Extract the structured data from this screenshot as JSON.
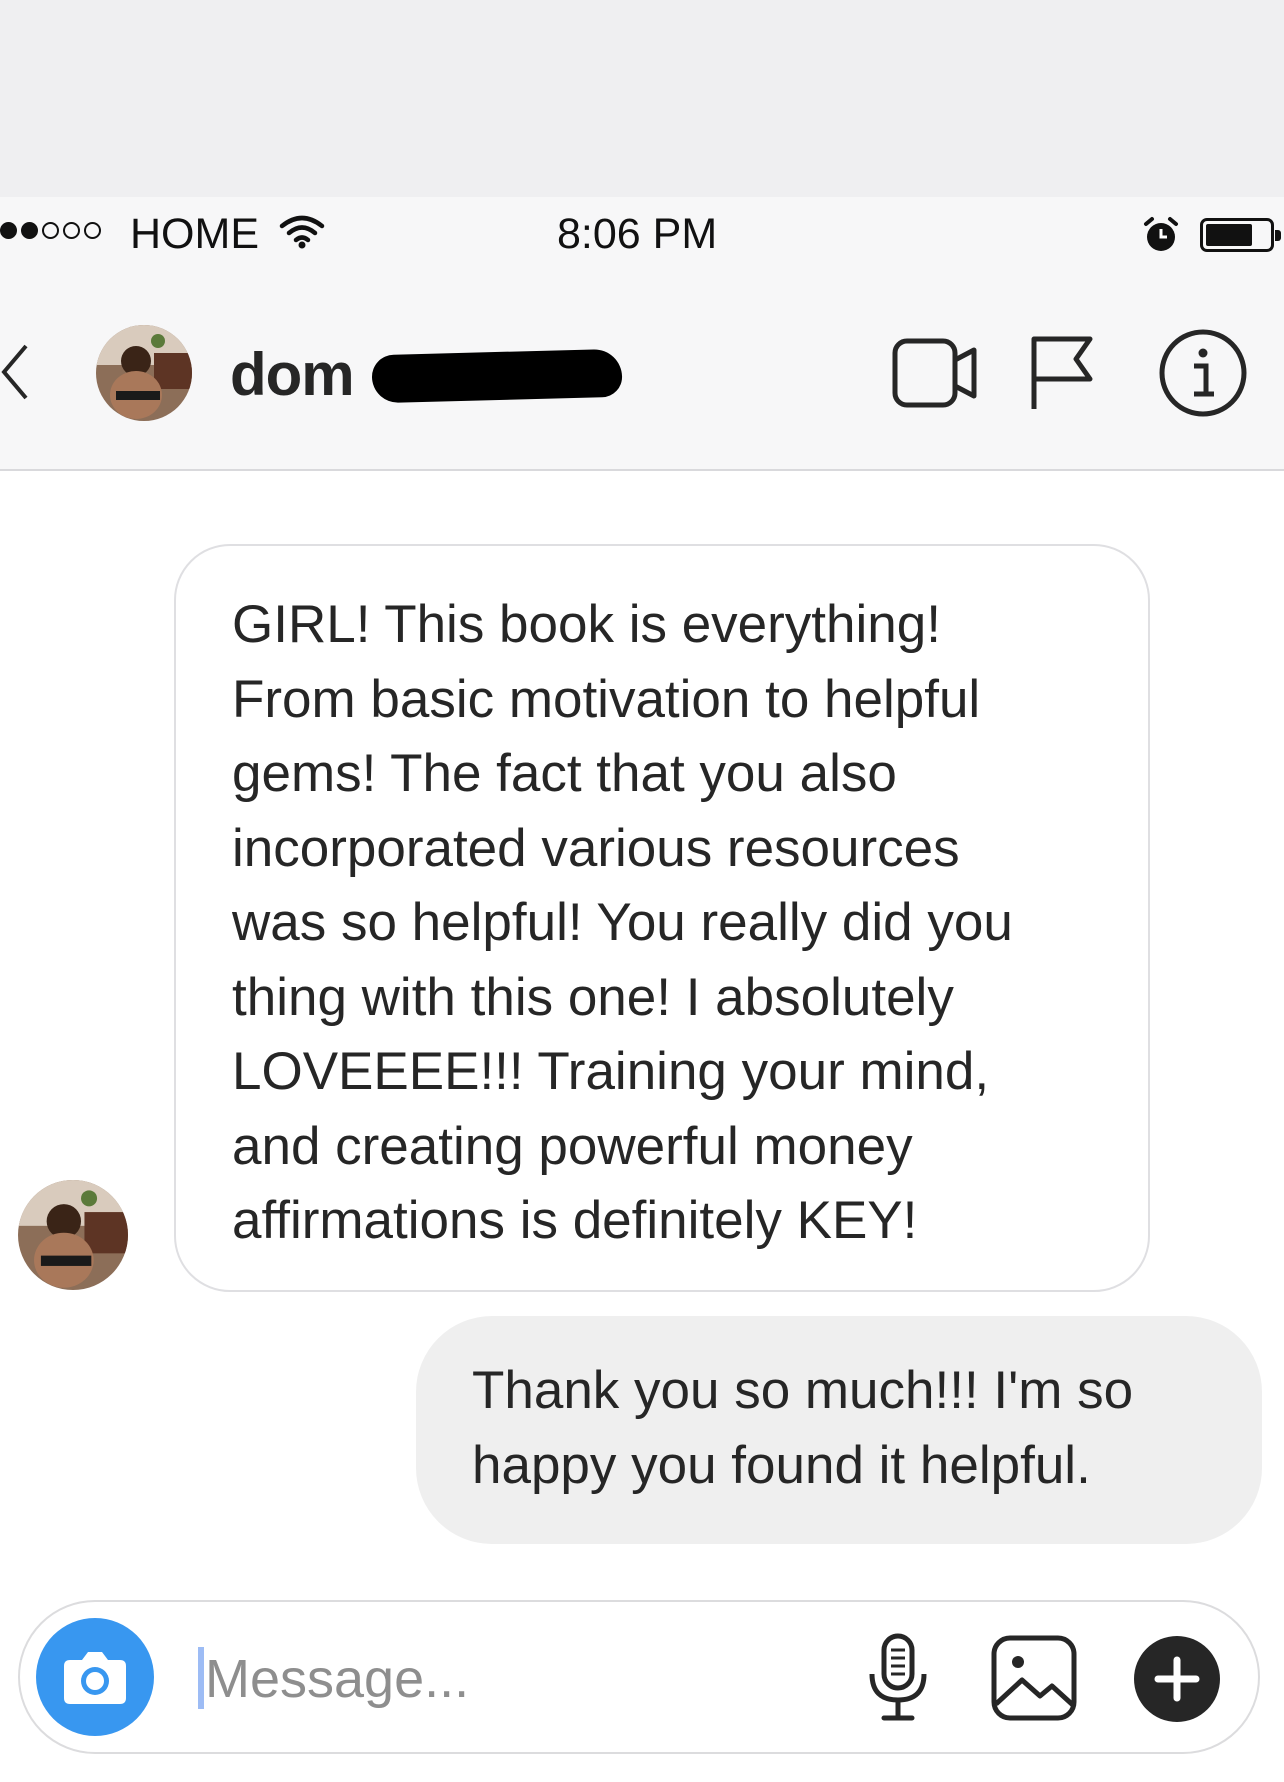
{
  "status_bar": {
    "carrier": "HOME",
    "time": "8:06 PM",
    "signal_bars_filled": 2,
    "signal_bars_total": 5,
    "battery_level": 0.7
  },
  "header": {
    "username_visible": "dom",
    "icons": [
      "back-chevron-icon",
      "video-call-icon",
      "flag-icon",
      "info-icon"
    ]
  },
  "messages": [
    {
      "direction": "incoming",
      "lines": [
        "GIRL! This book is everything!",
        "From basic motivation to helpful",
        "gems! The fact that you also",
        "incorporated various resources",
        "was so helpful! You really did you",
        "thing with this one! I absolutely",
        "LOVEEEE!!! Training your mind,",
        "and creating powerful money",
        "affirmations is definitely KEY!"
      ]
    },
    {
      "direction": "outgoing",
      "lines": [
        "Thank you so much!!! I'm so",
        "happy you found it helpful."
      ]
    }
  ],
  "composer": {
    "placeholder": "Message...",
    "icons": [
      "camera-icon",
      "microphone-icon",
      "gallery-icon",
      "plus-icon"
    ]
  },
  "colors": {
    "accent": "#3897f0",
    "outgoing_bubble": "#efefef",
    "incoming_border": "#dfdfe2"
  }
}
